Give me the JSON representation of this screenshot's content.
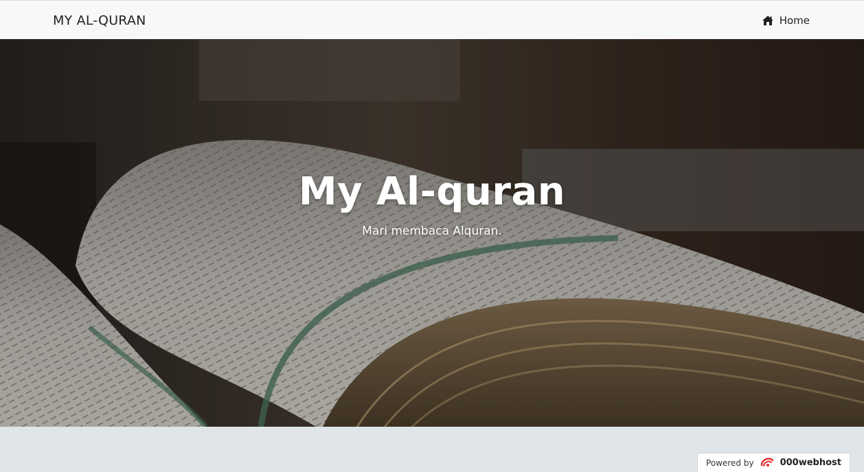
{
  "navbar": {
    "brand": "MY AL-QURAN",
    "home_label": "Home",
    "home_icon": "home-icon"
  },
  "hero": {
    "title": "My Al-quran",
    "subtitle": "Mari membaca Alquran.",
    "overlay_color": "#000000"
  },
  "footer": {
    "powered_by": "Powered by",
    "host_name": "000webhost",
    "host_logo_color": "#e8262a"
  }
}
